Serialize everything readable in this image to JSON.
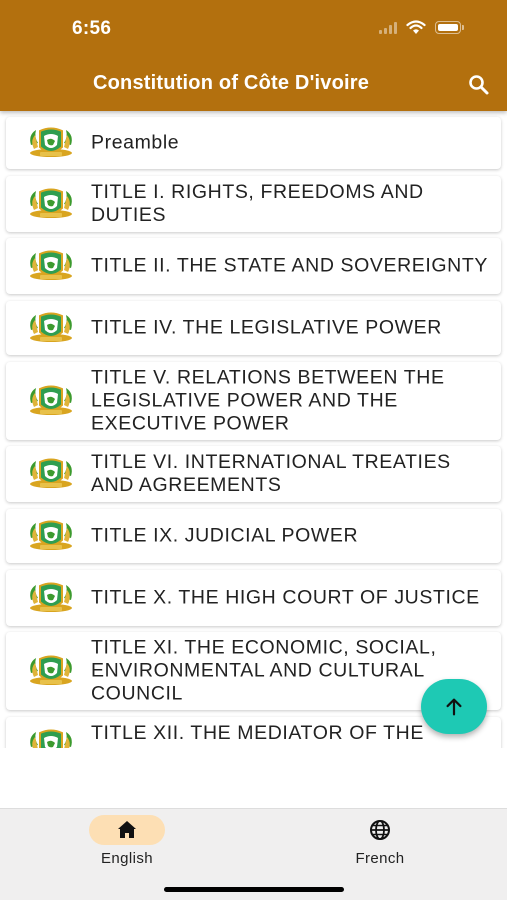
{
  "status_bar": {
    "time": "6:56"
  },
  "app_bar": {
    "title": "Constitution of Côte D'ivoire",
    "search_icon": "search-icon"
  },
  "list": {
    "items": [
      {
        "label": "Preamble"
      },
      {
        "label": "TITLE I. RIGHTS, FREEDOMS AND DUTIES"
      },
      {
        "label": "TITLE II. THE STATE AND SOVEREIGNTY"
      },
      {
        "label": "TITLE IV. THE LEGISLATIVE POWER"
      },
      {
        "label": "TITLE V. RELATIONS BETWEEN THE LEGISLATIVE POWER AND THE EXECUTIVE POWER"
      },
      {
        "label": "TITLE VI. INTERNATIONAL TREATIES AND AGREEMENTS"
      },
      {
        "label": "TITLE IX. JUDICIAL POWER"
      },
      {
        "label": "TITLE X. THE HIGH COURT OF JUSTICE"
      },
      {
        "label": "TITLE XI. THE ECONOMIC, SOCIAL, ENVIRONMENTAL AND CULTURAL COUNCIL"
      },
      {
        "label": "TITLE XII. THE MEDIATOR OF THE REPUBLIC"
      }
    ]
  },
  "fab": {
    "icon": "arrow-up-icon"
  },
  "bottom_nav": {
    "items": [
      {
        "label": "English",
        "icon": "home-icon",
        "active": true
      },
      {
        "label": "French",
        "icon": "globe-icon",
        "active": false
      }
    ]
  },
  "colors": {
    "app_bar": "#b3700e",
    "fab": "#1ec9b4",
    "active_pill": "#fddfb4",
    "nav_background": "#f0efef"
  }
}
